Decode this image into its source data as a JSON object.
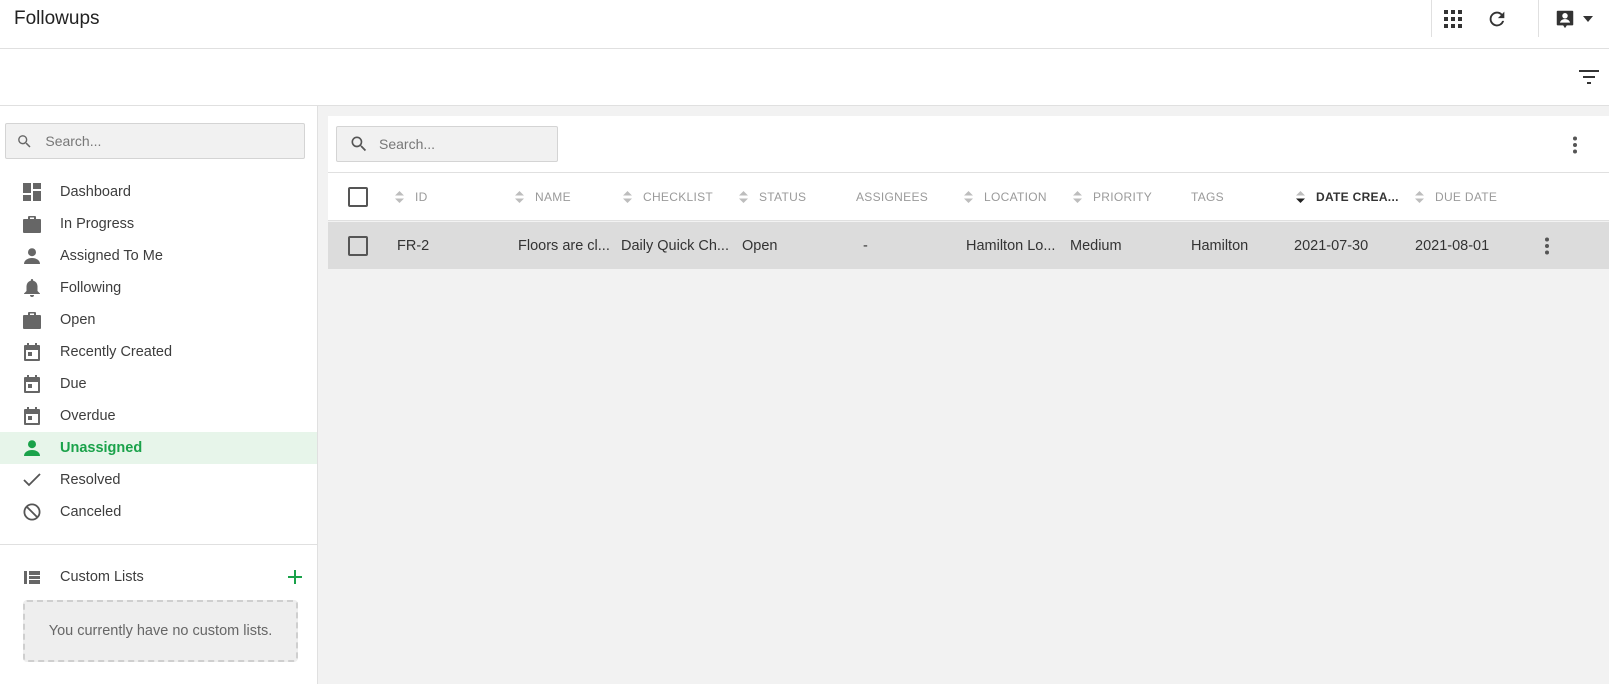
{
  "app": {
    "title": "Followups"
  },
  "header": {
    "icons": [
      "apps-grid-icon",
      "refresh-icon",
      "account-box-icon",
      "caret-down-icon"
    ]
  },
  "filter_icon": "filter-list-icon",
  "sidebar": {
    "search_placeholder": "Search...",
    "items": [
      {
        "label": "Dashboard",
        "icon": "dashboard-icon"
      },
      {
        "label": "In Progress",
        "icon": "briefcase-icon"
      },
      {
        "label": "Assigned To Me",
        "icon": "person-icon"
      },
      {
        "label": "Following",
        "icon": "bell-icon"
      },
      {
        "label": "Open",
        "icon": "briefcase-icon"
      },
      {
        "label": "Recently Created",
        "icon": "calendar-icon"
      },
      {
        "label": "Due",
        "icon": "calendar-icon"
      },
      {
        "label": "Overdue",
        "icon": "calendar-icon"
      },
      {
        "label": "Unassigned",
        "icon": "person-icon",
        "active": true
      },
      {
        "label": "Resolved",
        "icon": "check-icon"
      },
      {
        "label": "Canceled",
        "icon": "block-icon"
      }
    ],
    "custom_lists": {
      "label": "Custom Lists",
      "empty_text": "You currently have no custom lists."
    }
  },
  "main": {
    "search_placeholder": "Search...",
    "columns": {
      "id": "ID",
      "name": "NAME",
      "checklist": "CHECKLIST",
      "status": "STATUS",
      "assignees": "ASSIGNEES",
      "location": "LOCATION",
      "priority": "PRIORITY",
      "tags": "TAGS",
      "date_created": "DATE CREA...",
      "due_date": "DUE DATE"
    },
    "sorted_column": "date_created",
    "sort_direction": "descending",
    "rows": [
      {
        "id": "FR-2",
        "name": "Floors are cl...",
        "checklist": "Daily Quick Ch...",
        "status": "Open",
        "assignees": "-",
        "location": "Hamilton Lo...",
        "priority": "Medium",
        "tags": "Hamilton",
        "date_created": "2021-07-30",
        "due_date": "2021-08-01"
      }
    ]
  },
  "colors": {
    "accent": "#1aa24a",
    "active_bg": "#e7f5ea",
    "row_bg": "#dcdcdc",
    "panel_bg": "#f2f2f2"
  }
}
